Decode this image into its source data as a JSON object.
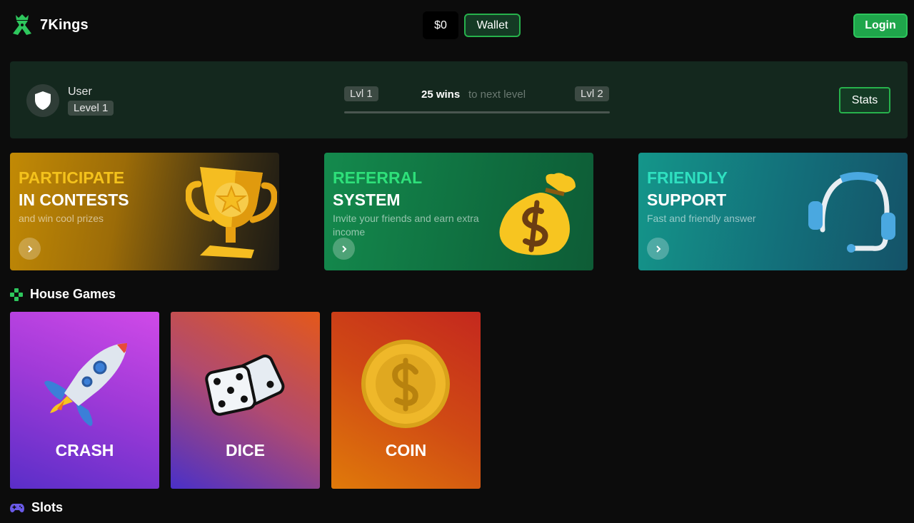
{
  "header": {
    "logo_text": "7Kings",
    "balance": "$0",
    "wallet_label": "Wallet",
    "login_label": "Login"
  },
  "profile": {
    "username": "User",
    "level_badge": "Level 1",
    "current_level": "Lvl 1",
    "next_level": "Lvl 2",
    "wins_needed": "25 wins",
    "wins_suffix": "to next level",
    "progress_fraction": 0,
    "stats_label": "Stats"
  },
  "promos": [
    {
      "title_accent": "PARTICIPATE",
      "title": "IN CONTESTS",
      "description": "and win cool prizes",
      "accent_color": "#f4c21c",
      "icon": "trophy-icon"
    },
    {
      "title_accent": "REFERRAL",
      "title": "SYSTEM",
      "description": "Invite your friends and earn extra income",
      "accent_color": "#2ee07a",
      "icon": "money-bag-icon"
    },
    {
      "title_accent": "FRIENDLY",
      "title": "SUPPORT",
      "description": "Fast and friendly answer",
      "accent_color": "#2fe0c0",
      "icon": "headset-icon"
    }
  ],
  "sections": {
    "house_games": "House Games",
    "slots": "Slots"
  },
  "games": [
    {
      "name": "CRASH",
      "icon": "rocket-icon"
    },
    {
      "name": "DICE",
      "icon": "dice-icon"
    },
    {
      "name": "COIN",
      "icon": "coin-icon"
    }
  ],
  "colors": {
    "brand_green": "#2ec75d",
    "background": "#0c0c0c",
    "profile_bg": "#14281e"
  }
}
